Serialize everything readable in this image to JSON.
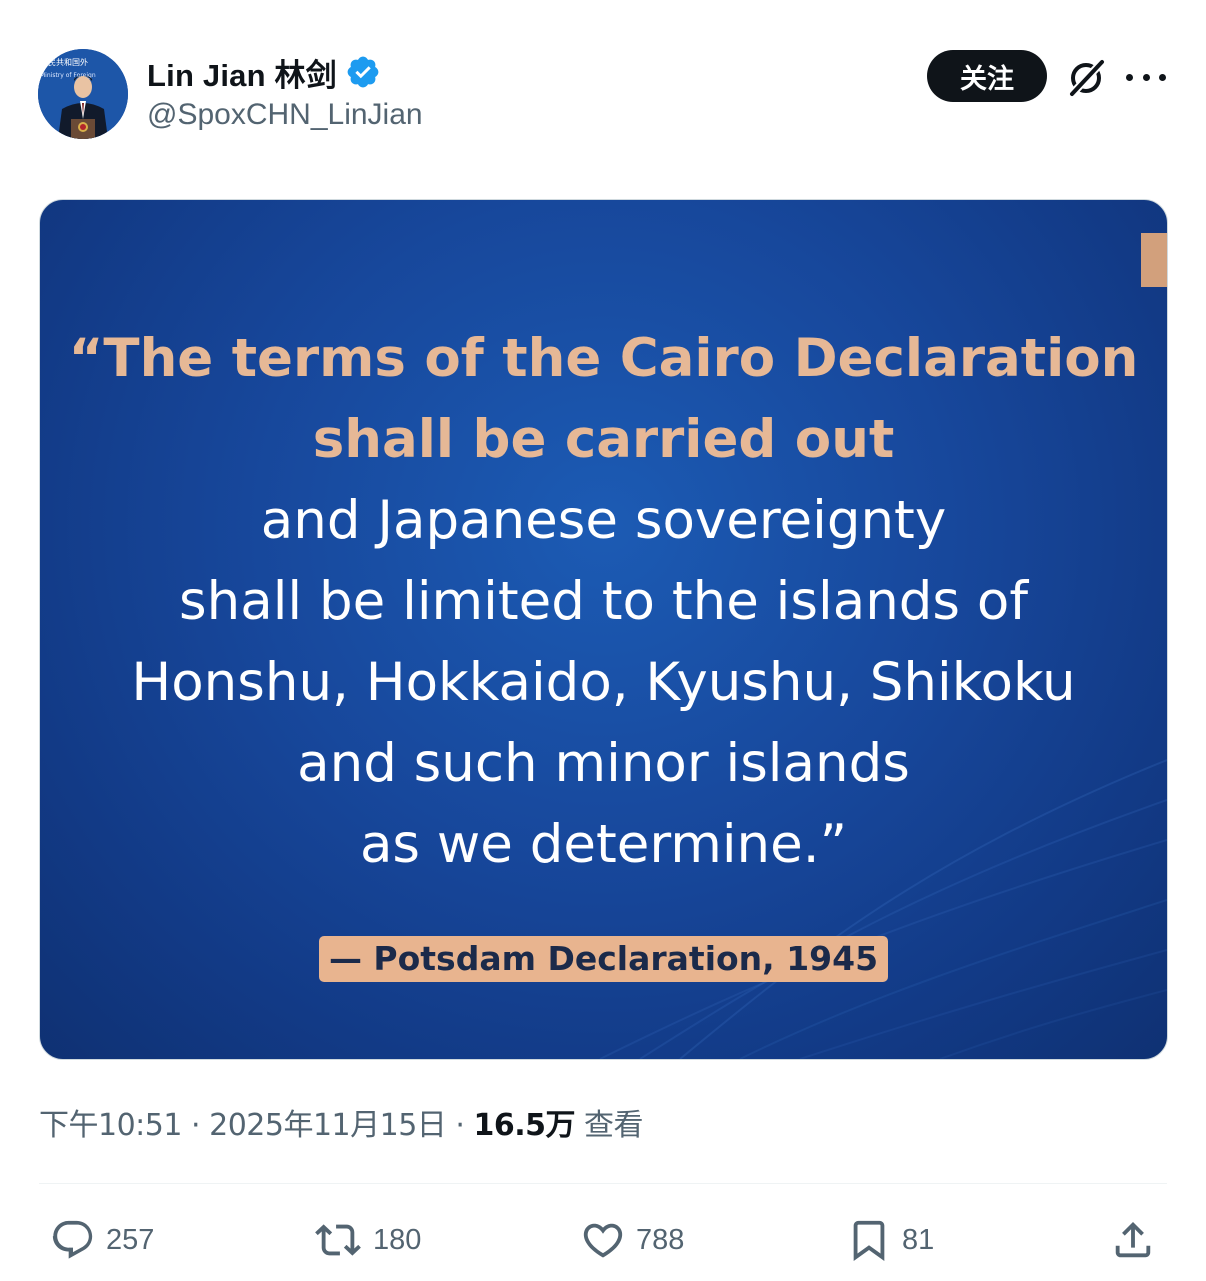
{
  "author": {
    "display_name": "Lin Jian 林剑",
    "handle": "@SpoxCHN_LinJian",
    "verified": true,
    "avatar_backdrop_text": "中华人民共和国外交部 Ministry of Foreign Affairs"
  },
  "header": {
    "follow_label": "关注",
    "grok_icon": "grok-icon",
    "more_icon": "more-icon"
  },
  "media": {
    "quote_lines": [
      {
        "text": "“The terms of the Cairo Declaration",
        "color": "gold"
      },
      {
        "text": "shall be carried out",
        "color": "gold"
      },
      {
        "text": "and Japanese sovereignty",
        "color": "white"
      },
      {
        "text": "shall be limited to the islands of",
        "color": "white"
      },
      {
        "text": "Honshu, Hokkaido, Kyushu, Shikoku",
        "color": "white"
      },
      {
        "text": "and such minor islands",
        "color": "white"
      },
      {
        "text": "as we determine.”",
        "color": "white"
      }
    ],
    "source": "— Potsdam Declaration, 1945",
    "colors": {
      "background": "#17479b",
      "gold_text": "#e6b896",
      "source_badge": "#e8b48f",
      "corner_tab": "#d2a07c"
    }
  },
  "meta": {
    "time": "下午10:51",
    "date": "2025年11月15日",
    "views_count": "16.5万",
    "views_label": "查看",
    "separator": "·"
  },
  "actions": {
    "replies": "257",
    "reposts": "180",
    "likes": "788",
    "bookmarks": "81",
    "icons": [
      "reply-icon",
      "repost-icon",
      "like-icon",
      "bookmark-icon",
      "share-icon"
    ]
  },
  "colors": {
    "text_primary": "#0f1419",
    "text_secondary": "#536471",
    "verified_blue": "#1d9bf0",
    "divider": "#eff3f4"
  }
}
